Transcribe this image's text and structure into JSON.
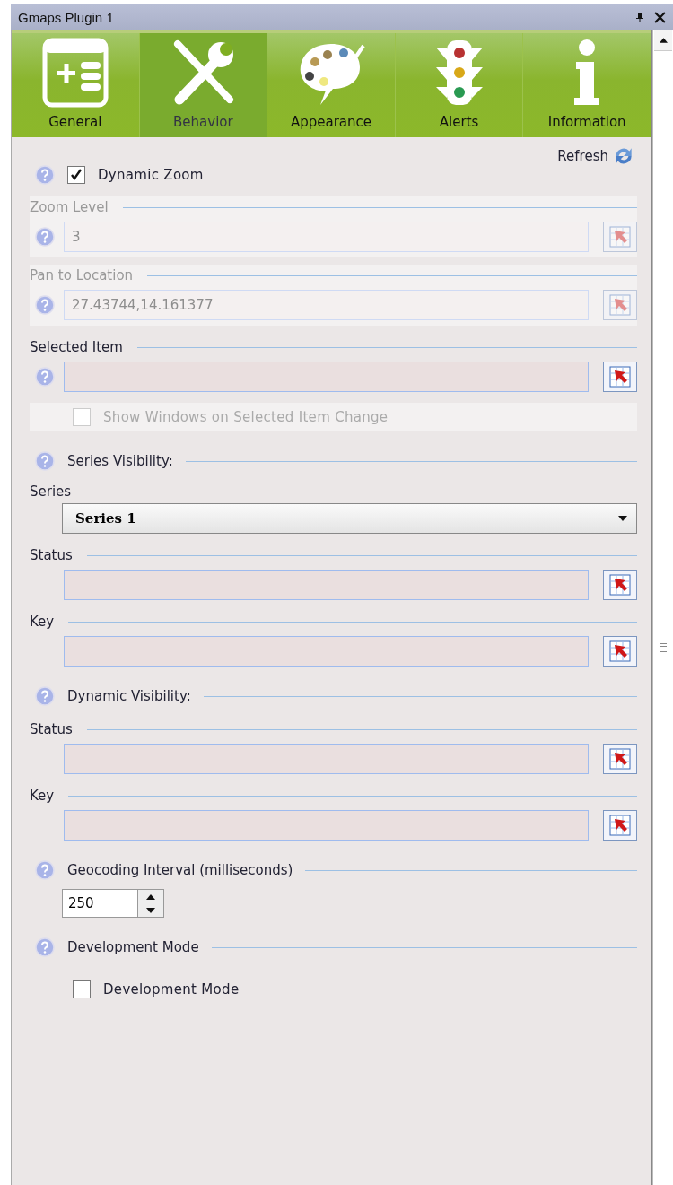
{
  "window": {
    "title": "Gmaps Plugin 1"
  },
  "tabs": [
    {
      "label": "General",
      "selected": false
    },
    {
      "label": "Behavior",
      "selected": true
    },
    {
      "label": "Appearance",
      "selected": false
    },
    {
      "label": "Alerts",
      "selected": false
    },
    {
      "label": "Information",
      "selected": false
    }
  ],
  "refresh": {
    "label": "Refresh"
  },
  "sections": [
    {
      "kind": "checkbox",
      "label": "Dynamic Zoom",
      "checked": true,
      "disabled": false,
      "help": true
    },
    {
      "kind": "field",
      "label": "Zoom Level",
      "value": "3",
      "disabled": true,
      "help": true
    },
    {
      "kind": "field",
      "label": "Pan to Location",
      "value": "27.43744,14.161377",
      "disabled": true,
      "help": true
    },
    {
      "kind": "field",
      "label": "Selected Item",
      "disabled": false,
      "help": true
    },
    {
      "kind": "checkbox",
      "label": "Show Windows on Selected Item Change",
      "checked": false,
      "disabled": true,
      "help": false
    },
    {
      "kind": "heading",
      "label": "Series Visibility:",
      "help": true
    },
    {
      "kind": "dropdown",
      "label": "Series",
      "value": "Series 1"
    },
    {
      "kind": "field",
      "label": "Status",
      "disabled": false,
      "help": false
    },
    {
      "kind": "field",
      "label": "Key",
      "disabled": false,
      "help": false
    },
    {
      "kind": "heading",
      "label": "Dynamic Visibility:",
      "help": true
    },
    {
      "kind": "field",
      "label": "Status",
      "disabled": false,
      "help": false
    },
    {
      "kind": "field",
      "label": "Key",
      "disabled": false,
      "help": false
    },
    {
      "kind": "heading",
      "label": "Geocoding Interval (milliseconds)",
      "help": true
    },
    {
      "kind": "spinner",
      "value": "250"
    },
    {
      "kind": "heading",
      "label": "Development Mode",
      "help": true
    },
    {
      "kind": "checkbox",
      "label": "Development Mode",
      "checked": false,
      "disabled": false,
      "help": false
    }
  ]
}
